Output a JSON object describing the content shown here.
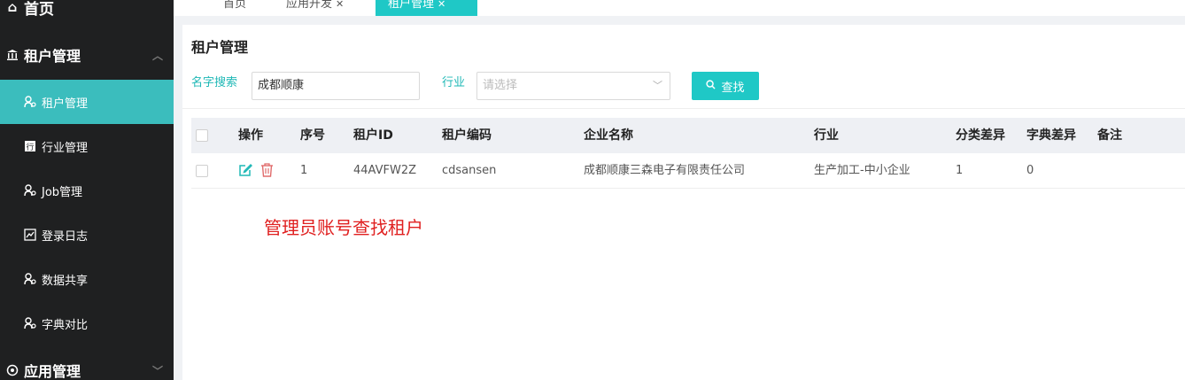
{
  "sidebar": {
    "top_label": "首页",
    "group_tenant": "租户管理",
    "items": [
      {
        "label": "租户管理",
        "icon": "users-icon"
      },
      {
        "label": "行业管理",
        "icon": "industry-icon"
      },
      {
        "label": "Job管理",
        "icon": "users-icon"
      },
      {
        "label": "登录日志",
        "icon": "chart-icon"
      },
      {
        "label": "数据共享",
        "icon": "users-icon"
      },
      {
        "label": "字典对比",
        "icon": "users-icon"
      }
    ],
    "group_app": "应用管理"
  },
  "tabs": [
    {
      "label": "首页"
    },
    {
      "label": "应用开发"
    },
    {
      "label": "租户管理"
    }
  ],
  "page": {
    "title": "租户管理",
    "search_name_label": "名字搜索",
    "search_name_value": "成都顺康",
    "industry_label": "行业",
    "industry_placeholder": "请选择",
    "search_button": "查找"
  },
  "table": {
    "headers": [
      "操作",
      "序号",
      "租户ID",
      "租户编码",
      "企业名称",
      "行业",
      "分类差异",
      "字典差异",
      "备注"
    ],
    "rows": [
      {
        "index": "1",
        "tenant_id": "44AVFW2Z",
        "code": "cdsansen",
        "company": "成都顺康三森电子有限责任公司",
        "industry": "生产加工-中小企业",
        "category_diff": "1",
        "dict_diff": "0",
        "remark": ""
      }
    ]
  },
  "annotation": "管理员账号查找租户",
  "colors": {
    "accent": "#1fc8c6",
    "sidebar_bg": "#1f2021",
    "active_item": "#3bbdbd",
    "danger": "#e02020"
  }
}
